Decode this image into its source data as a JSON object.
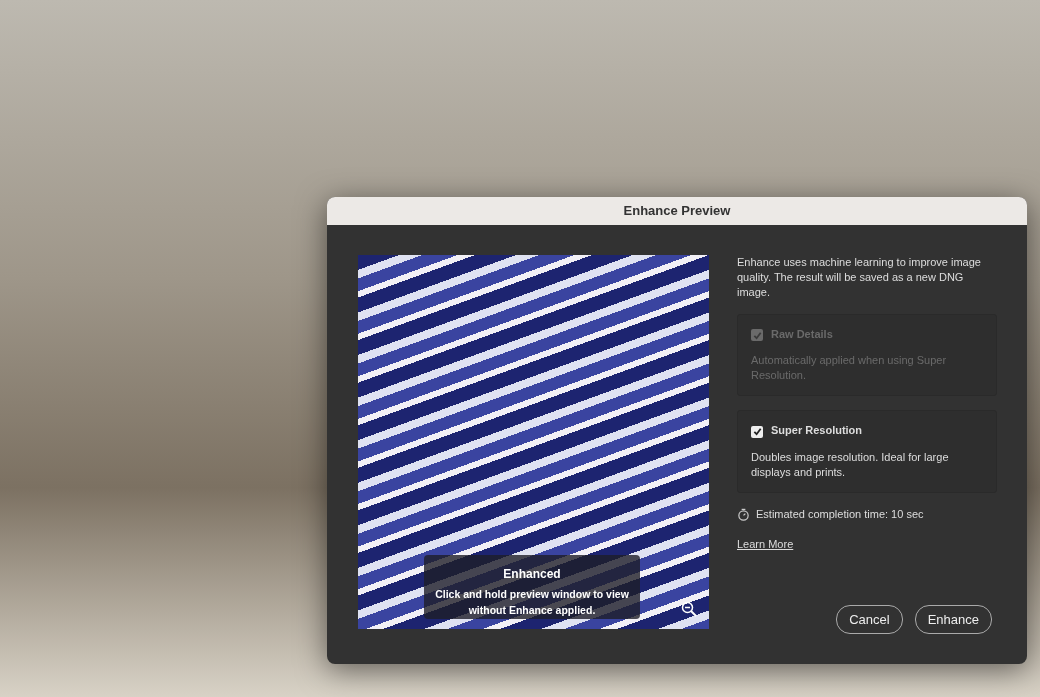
{
  "dialog": {
    "title": "Enhance Preview",
    "preview": {
      "caption_title": "Enhanced",
      "caption_text": "Click and hold preview window to view without Enhance applied."
    },
    "description": "Enhance uses machine learning to improve image quality. The result will be saved as a new DNG image.",
    "options": [
      {
        "label": "Raw Details",
        "description": "Automatically applied when using Super Resolution.",
        "checked": true,
        "disabled": true
      },
      {
        "label": "Super Resolution",
        "description": "Doubles image resolution. Ideal for large displays and prints.",
        "checked": true,
        "disabled": false
      }
    ],
    "estimate": "Estimated completion time: 10 sec",
    "link": "Learn More",
    "buttons": [
      "Cancel",
      "Enhance"
    ]
  }
}
